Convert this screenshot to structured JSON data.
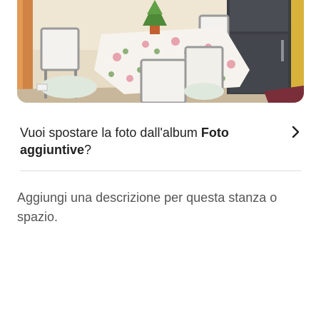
{
  "photo": {
    "alt": ""
  },
  "move_prompt": {
    "prefix": "Vuoi spostare la foto dall'album ",
    "album_name": "Foto aggiuntive",
    "suffix": "?"
  },
  "description": {
    "placeholder": "Aggiungi una descrizione per questa stanza o spazio."
  },
  "icons": {
    "chevron": "chevron-right-icon"
  },
  "colors": {
    "text": "#222222",
    "muted": "#555555",
    "divider": "#dddddd"
  }
}
